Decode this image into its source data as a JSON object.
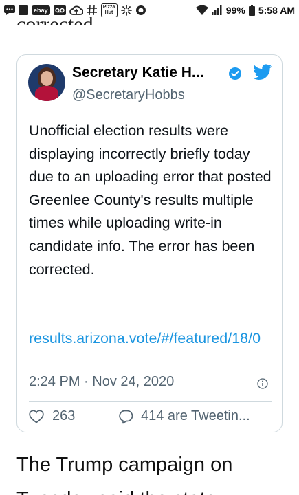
{
  "status_bar": {
    "left_icons": [
      "message-icon",
      "square-icon",
      "ebay-icon",
      "voicemail-icon",
      "cloud-upload-icon",
      "hashtag-icon",
      "pizza-hut-icon",
      "snowflake-icon",
      "circle-app-icon"
    ],
    "ebay_label": "ebay",
    "pizza_label": "Pizza Hut",
    "battery": "99%",
    "time": "5:58 AM"
  },
  "prev_text": "corrected.",
  "tweet": {
    "author_name": "Secretary Katie H...",
    "handle": "@SecretaryHobbs",
    "body": "Unofficial election results were displaying incorrectly briefly today due to an uploading error that posted Greenlee County's results multiple times while uploading write-in candidate info. The error has been corrected.",
    "link": "results.arizona.vote/#/featured/18/0",
    "timestamp": "2:24 PM · Nov 24, 2020",
    "likes": "263",
    "replies_label": "414 are Tweetin..."
  },
  "article": {
    "line1": "The Trump campaign on",
    "line2": "Tuesday said the state"
  },
  "colors": {
    "link": "#1b95e0",
    "verified": "#1d9bf0",
    "secondary_text": "#536471",
    "border": "#cfd9de"
  }
}
